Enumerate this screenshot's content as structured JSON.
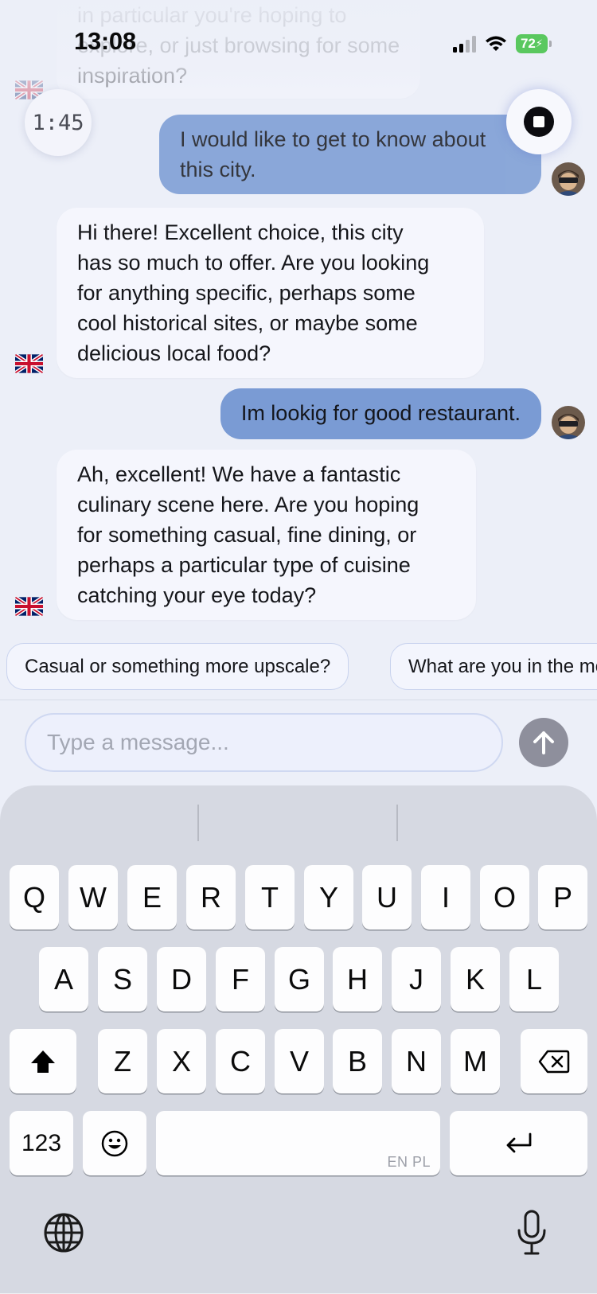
{
  "status_bar": {
    "time": "13:08",
    "battery": "72"
  },
  "timer": {
    "label": "1:45"
  },
  "messages": [
    {
      "role": "ai",
      "lines": [
        "in particular you're hoping to",
        "explore, or just browsing for some",
        "inspiration?"
      ]
    },
    {
      "role": "user",
      "lines": [
        "I would like to get to know about",
        "this city."
      ]
    },
    {
      "role": "ai",
      "lines": [
        "Hi there! Excellent choice, this city",
        "has so much to offer. Are you looking",
        "for anything specific, perhaps some",
        "cool historical sites, or maybe some",
        "delicious local food?"
      ]
    },
    {
      "role": "user",
      "lines": [
        "Im lookig for good restaurant."
      ]
    },
    {
      "role": "ai",
      "lines": [
        "Ah, excellent! We have a fantastic",
        "culinary scene here. Are you hoping",
        "for something casual, fine dining, or",
        "perhaps a particular type of cuisine",
        "catching your eye today?"
      ]
    }
  ],
  "suggestions": [
    "Casual or something more upscale?",
    "What are you in the mood for?"
  ],
  "composer": {
    "placeholder": "Type a message..."
  },
  "keyboard": {
    "row1": [
      "Q",
      "W",
      "E",
      "R",
      "T",
      "Y",
      "U",
      "I",
      "O",
      "P"
    ],
    "row2": [
      "A",
      "S",
      "D",
      "F",
      "G",
      "H",
      "J",
      "K",
      "L"
    ],
    "row3": [
      "Z",
      "X",
      "C",
      "V",
      "B",
      "N",
      "M"
    ],
    "numbers_label": "123",
    "space_hint": "EN PL"
  },
  "colors": {
    "user_bubble": "#7a9bd4",
    "ai_bubble": "#f5f6fd",
    "battery": "#5ac85f",
    "send_button": "#8e8f9c"
  }
}
